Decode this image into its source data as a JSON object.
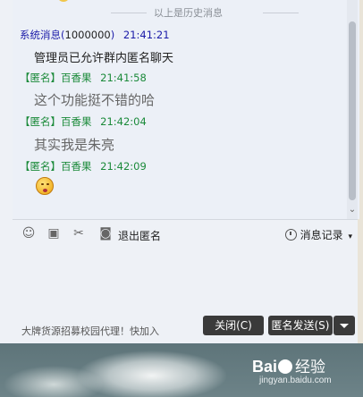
{
  "history_divider": "以上是历史消息",
  "messages": [
    {
      "sender": "系统消息",
      "id": "1000000",
      "time": "21:41:21",
      "text": "管理员已允许群内匿名聊天"
    },
    {
      "sender": "【匿名】百香果",
      "time": "21:41:58",
      "text": "这个功能挺不错的哈"
    },
    {
      "sender": "【匿名】百香果",
      "time": "21:42:04",
      "text": "其实我是朱亮"
    },
    {
      "sender": "【匿名】百香果",
      "time": "21:42:09",
      "text": ""
    }
  ],
  "toolbar": {
    "exit_anonymous": "退出匿名",
    "history": "消息记录"
  },
  "footer": {
    "ad_text": "大牌货源招募校园代理！快加入",
    "close_button": "关闭(C)",
    "send_button": "匿名发送(S)"
  },
  "watermark": {
    "logo_text_1": "Bai",
    "logo_text_2": "经验",
    "url": "jingyan.baidu.com"
  },
  "colors": {
    "system_sender": "#1a1aa8",
    "anon_sender": "#1b8a3a",
    "button_bg": "#3a3a3a"
  },
  "icons": [
    "smiley-icon",
    "image-icon",
    "scissors-icon",
    "anonymous-mask-icon",
    "clock-icon",
    "chevron-down-icon"
  ]
}
